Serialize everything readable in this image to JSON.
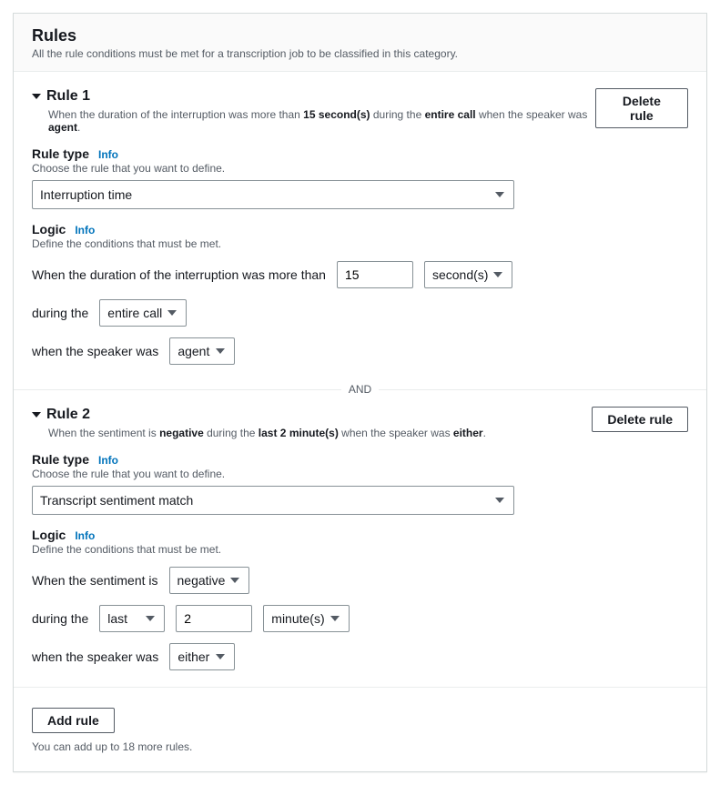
{
  "header": {
    "title": "Rules",
    "description": "All the rule conditions must be met for a transcription job to be classified in this category."
  },
  "labels": {
    "delete_rule": "Delete rule",
    "rule_type": "Rule type",
    "info": "Info",
    "rule_type_hint": "Choose the rule that you want to define.",
    "logic": "Logic",
    "logic_hint": "Define the conditions that must be met.",
    "and": "AND",
    "add_rule": "Add rule"
  },
  "rule1": {
    "title": "Rule 1",
    "summary_pre": "When the duration of the interruption was more than ",
    "summary_dur": "15 second(s)",
    "summary_mid": " during the ",
    "summary_period": "entire call",
    "summary_mid2": " when the speaker was ",
    "summary_speaker": "agent",
    "summary_end": ".",
    "rule_type_value": "Interruption time",
    "line1_label": "When the duration of the interruption was more than",
    "line1_value": "15",
    "line1_unit": "second(s)",
    "line2_label": "during the",
    "line2_value": "entire call",
    "line3_label": "when the speaker was",
    "line3_value": "agent"
  },
  "rule2": {
    "title": "Rule 2",
    "summary_pre": "When the sentiment is ",
    "summary_sent": "negative",
    "summary_mid": " during the ",
    "summary_period": "last 2 minute(s)",
    "summary_mid2": " when the speaker was ",
    "summary_speaker": "either",
    "summary_end": ".",
    "rule_type_value": "Transcript sentiment match",
    "line1_label": "When the sentiment is",
    "line1_value": "negative",
    "line2_label": "during the",
    "line2_sel": "last",
    "line2_value": "2",
    "line2_unit": "minute(s)",
    "line3_label": "when the speaker was",
    "line3_value": "either"
  },
  "footer": {
    "hint": "You can add up to 18 more rules."
  }
}
